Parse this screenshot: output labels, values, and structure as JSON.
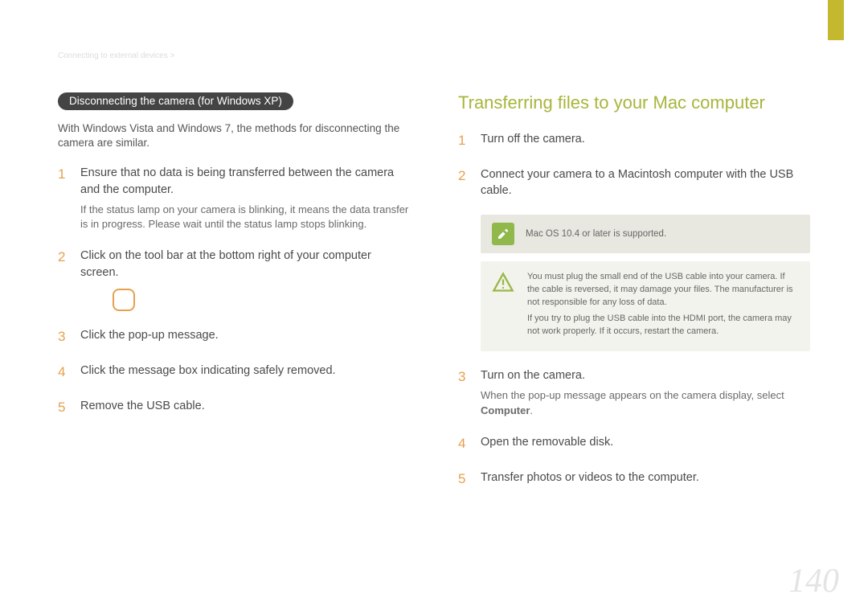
{
  "breadcrumb": "Connecting to external devices >",
  "page_number": "140",
  "left": {
    "pill": "Disconnecting the camera (for Windows XP)",
    "intro": "With Windows Vista and Windows 7, the methods for disconnecting the camera are similar.",
    "steps": [
      {
        "num": "1",
        "text": "Ensure that no data is being transferred between the camera and the computer.",
        "sub": "If the status lamp on your camera is blinking, it means the data transfer is in progress. Please wait until the status lamp stops blinking."
      },
      {
        "num": "2",
        "text_pre": "Click ",
        "text_post": " on the tool bar at the bottom right of your computer screen.",
        "has_icon": true
      },
      {
        "num": "3",
        "text": "Click the pop-up message."
      },
      {
        "num": "4",
        "text": "Click the message box indicating safely removed."
      },
      {
        "num": "5",
        "text": "Remove the USB cable."
      }
    ]
  },
  "right": {
    "title": "Transferring files to your Mac computer",
    "steps_a": [
      {
        "num": "1",
        "text": "Turn off the camera."
      },
      {
        "num": "2",
        "text": "Connect your camera to a Macintosh computer with the USB cable."
      }
    ],
    "note": "Mac OS 10.4 or later is supported.",
    "warn1": "You must plug the small end of the USB cable into your camera. If the cable is reversed, it may damage your files. The manufacturer is not responsible for any loss of data.",
    "warn2": "If you try to plug the USB cable into the HDMI port, the camera may not work properly. If it occurs, restart the camera.",
    "steps_b": [
      {
        "num": "3",
        "text": "Turn on the camera.",
        "sub_pre": "When the pop-up message appears on the camera display, select ",
        "sub_bold": "Computer",
        "sub_post": "."
      },
      {
        "num": "4",
        "text": "Open the removable disk."
      },
      {
        "num": "5",
        "text": "Transfer photos or videos to the computer."
      }
    ]
  }
}
